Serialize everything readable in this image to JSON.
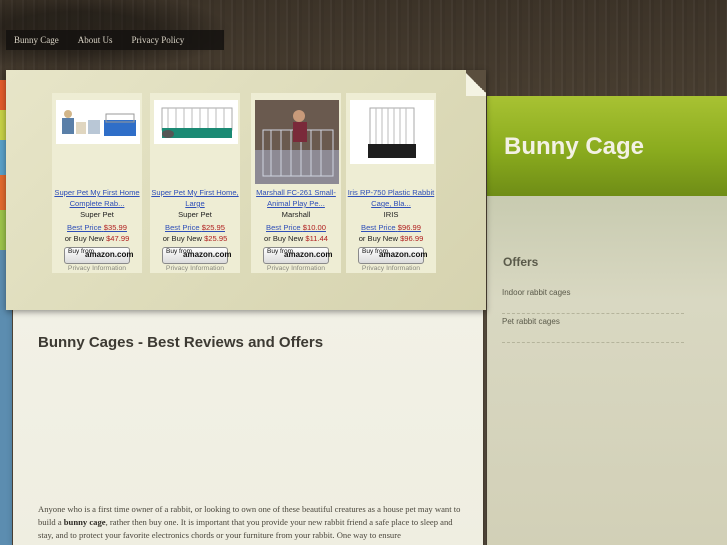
{
  "nav": {
    "items": [
      "Bunny Cage",
      "About Us",
      "Privacy Policy"
    ]
  },
  "header": {
    "site_title": "Bunny Cage"
  },
  "sidebar": {
    "heading": "Offers",
    "links": [
      "Indoor rabbit cages",
      "Pet rabbit cages"
    ]
  },
  "products": [
    {
      "title_line1": "Super Pet My First Home",
      "title_line2": "Complete Rab...",
      "brand": "Super Pet",
      "best_label": "Best Price",
      "best_price": "$35.99",
      "new_label": "or Buy New",
      "new_price": "$47.99",
      "buy_label": "Buy from",
      "buy_brand": "amazon.com",
      "privacy": "Privacy Information",
      "image_icon": "rabbit-starter-kit-image"
    },
    {
      "title_line1": "Super Pet My First Home,",
      "title_line2": "Large",
      "brand": "Super Pet",
      "best_label": "Best Price",
      "best_price": "$25.95",
      "new_label": "or Buy New",
      "new_price": "$25.95",
      "buy_label": "Buy from",
      "buy_brand": "amazon.com",
      "privacy": "Privacy Information",
      "image_icon": "teal-cage-image"
    },
    {
      "title_line1": "Marshall FC-261 Small-",
      "title_line2": "Animal Play Pe...",
      "brand": "Marshall",
      "best_label": "Best Price",
      "best_price": "$10.00",
      "new_label": "or Buy New",
      "new_price": "$11.44",
      "buy_label": "Buy from",
      "buy_brand": "amazon.com",
      "privacy": "Privacy Information",
      "image_icon": "play-pen-image"
    },
    {
      "title_line1": "Iris RP-750 Plastic Rabbit",
      "title_line2": "Cage, Bla...",
      "brand": "IRIS",
      "best_label": "Best Price",
      "best_price": "$96.99",
      "new_label": "or Buy New",
      "new_price": "$96.99",
      "buy_label": "Buy from",
      "buy_brand": "amazon.com",
      "privacy": "Privacy Information",
      "image_icon": "black-cage-image"
    }
  ],
  "main": {
    "title": "Bunny Cages - Best Reviews and Offers",
    "para_start": "Anyone who is a first time owner of a rabbit, or looking to own one of these beautiful creatures as a house pet may want to build a ",
    "para_bold": "bunny cage",
    "para_end": ", rather then buy one. It is important that you provide your new rabbit friend a safe place to sleep and stay, and to protect your favorite electronics chords or your furniture from your rabbit. One way to ensure"
  }
}
